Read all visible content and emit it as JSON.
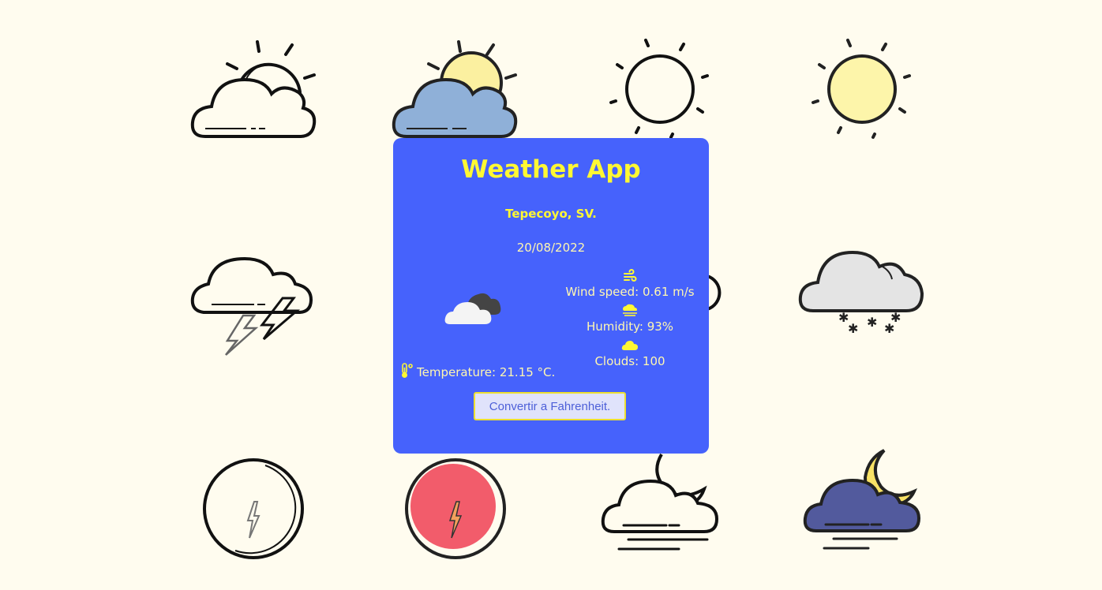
{
  "app": {
    "title": "Weather App",
    "location": "Tepecoyo, SV.",
    "date": "20/08/2022"
  },
  "stats": {
    "wind": "Wind speed: 0.61 m/s",
    "humidity": "Humidity: 93%",
    "clouds": "Clouds: 100"
  },
  "temperature": "Temperature: 21.15 °C.",
  "convert_button": "Convertir a Fahrenheit.",
  "icons": {
    "condition": "broken-clouds-icon",
    "wind": "wind-icon",
    "humidity": "humidity-icon",
    "clouds": "cloud-icon",
    "temperature": "thermometer-icon"
  },
  "colors": {
    "background": "#fffcef",
    "card": "#4662fc",
    "title": "#fff833",
    "text": "#fff7b0",
    "button_bg": "#e0e3fb",
    "button_border": "#ecdf30",
    "button_text": "#4d5fd8"
  }
}
